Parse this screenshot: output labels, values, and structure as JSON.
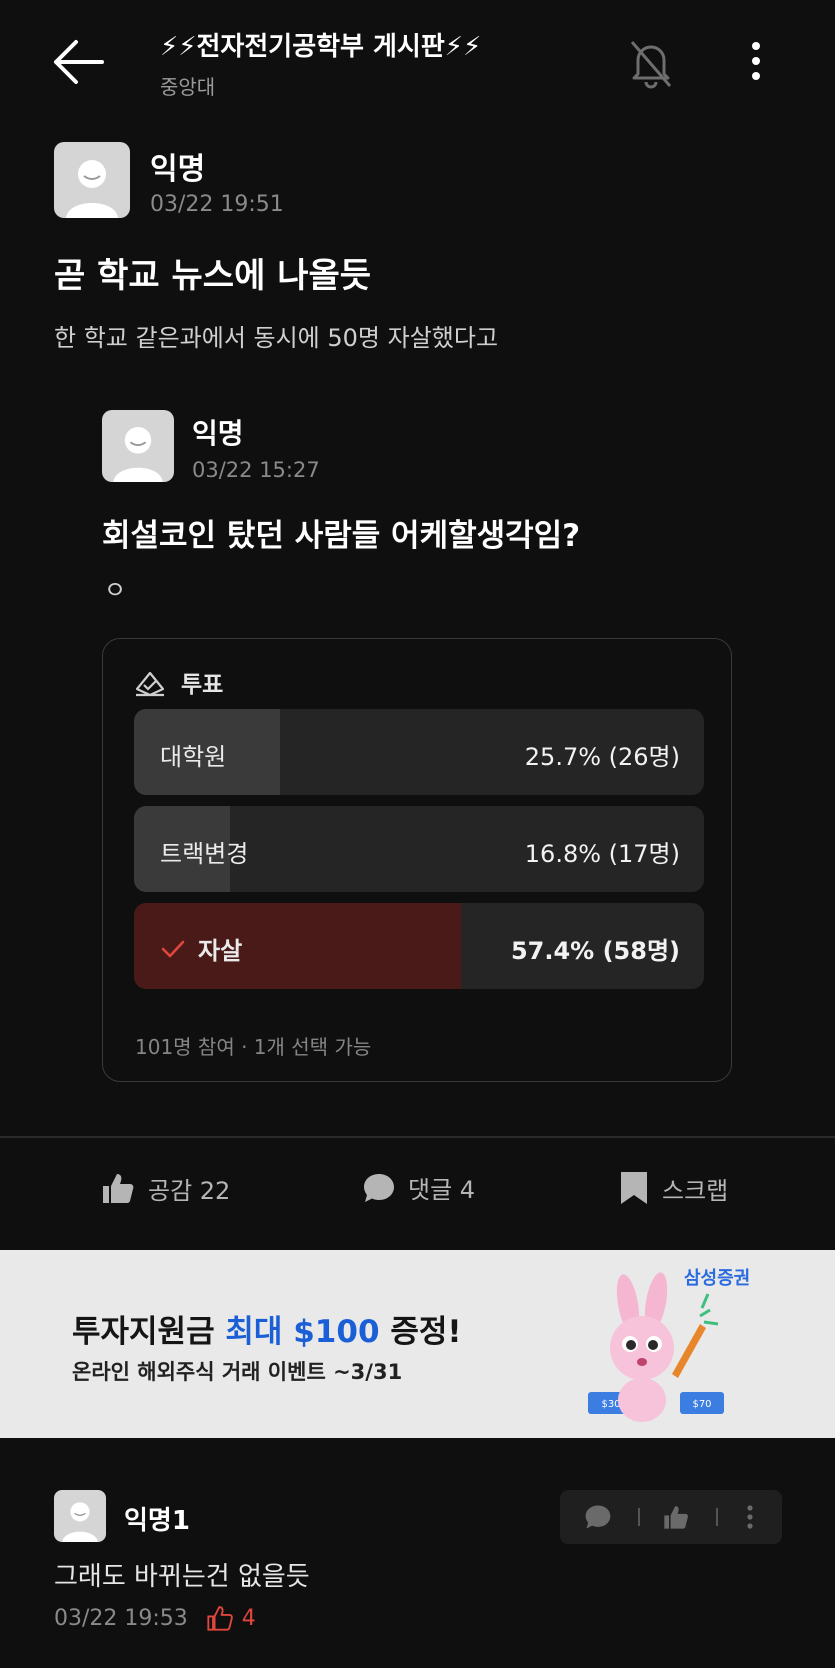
{
  "header": {
    "title": "⚡⚡전자전기공학부 게시판⚡⚡",
    "subtitle": "중앙대"
  },
  "post": {
    "author": "익명",
    "date": "03/22 19:51",
    "title": "곧 학교 뉴스에 나올듯",
    "body": "한 학교 같은과에서 동시에 50명 자살했다고"
  },
  "quoted": {
    "author": "익명",
    "date": "03/22 15:27",
    "title": "회설코인 탔던 사람들 어케할생각임?",
    "body": "ㅇ"
  },
  "poll": {
    "label": "투표",
    "options": [
      {
        "label": "대학원",
        "result": "25.7% (26명)",
        "fraction": 0.257,
        "selected": false
      },
      {
        "label": "트랙변경",
        "result": "16.8% (17명)",
        "fraction": 0.168,
        "selected": false
      },
      {
        "label": "자살",
        "result": "57.4% (58명)",
        "fraction": 0.574,
        "selected": true
      }
    ],
    "footer": "101명 참여 · 1개 선택 가능"
  },
  "actions": {
    "like": "공감 22",
    "comment": "댓글 4",
    "scrap": "스크랩"
  },
  "ad": {
    "line1_a": "투자지원금 ",
    "line1_b": "최대 $100",
    "line1_c": " 증정!",
    "line2": "온라인 해외주식 거래 이벤트 ~3/31",
    "brand": "삼성증권",
    "coupon_left": "$30",
    "coupon_right": "$70"
  },
  "comment": {
    "author": "익명1",
    "text": "그래도 바뀌는건 없을듯",
    "date": "03/22 19:53",
    "likes": "4"
  },
  "colors": {
    "background": "#0f0f0f",
    "selected_fill": "#4a1a18",
    "accent_red": "#e0463c",
    "ad_blue": "#1a5fd6"
  }
}
